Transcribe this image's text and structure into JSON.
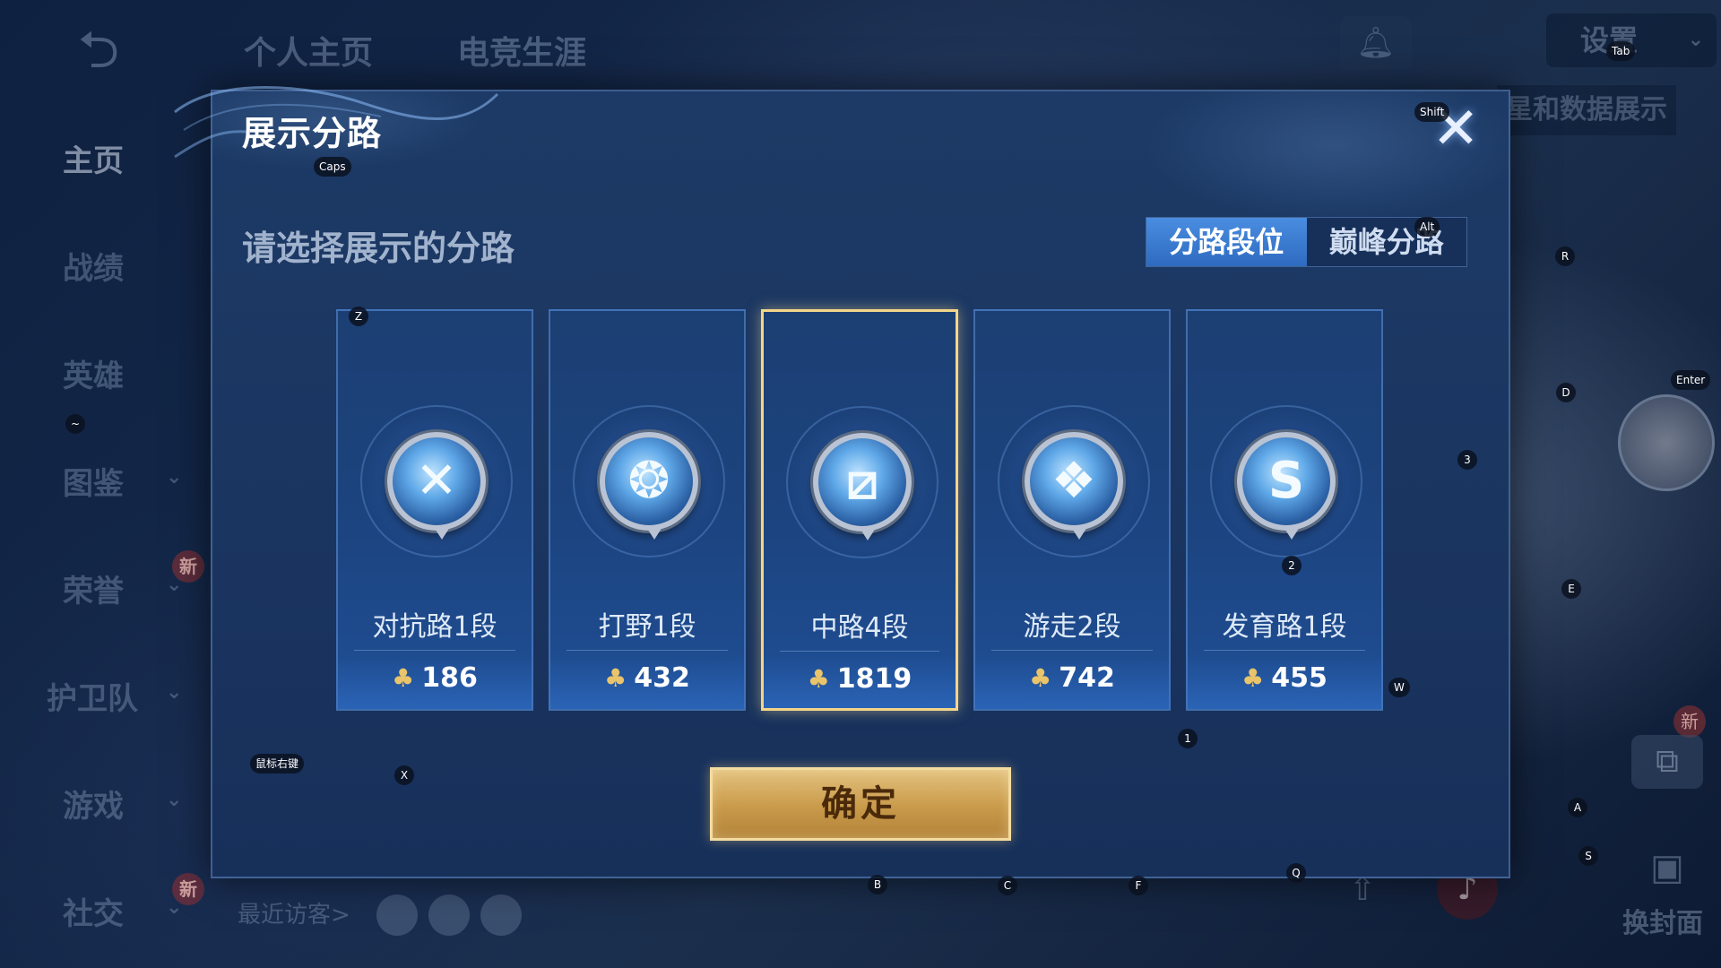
{
  "top_nav": {
    "back_icon": "back-arrow-icon",
    "tabs": [
      "个人主页",
      "电竞生涯"
    ],
    "settings_label": "设置",
    "peek_text": "星和数据展示"
  },
  "sidebar": {
    "items": [
      {
        "label": "主页"
      },
      {
        "label": "战绩"
      },
      {
        "label": "英雄"
      },
      {
        "label": "图鉴",
        "arrow": "⌄"
      },
      {
        "label": "荣誉",
        "arrow": "⌄",
        "badge": "新"
      },
      {
        "label": "护卫队",
        "arrow": "⌄"
      },
      {
        "label": "游戏",
        "arrow": "⌄"
      },
      {
        "label": "社交",
        "arrow": "⌄",
        "badge": "新"
      }
    ],
    "recent_visitors": "最近访客>"
  },
  "right_panel": {
    "new_badge": "新",
    "cover_label": "换封面"
  },
  "modal": {
    "title": "展示分路",
    "close_symbol": "✕",
    "subtitle": "请选择展示的分路",
    "tabs": [
      {
        "label": "分路段位",
        "active": true
      },
      {
        "label": "巅峰分路",
        "active": false
      }
    ],
    "cards": [
      {
        "rank": "对抗路1段",
        "score": "186",
        "emblem": "✕",
        "selected": false
      },
      {
        "rank": "打野1段",
        "score": "432",
        "emblem": "❂",
        "selected": false
      },
      {
        "rank": "中路4段",
        "score": "1819",
        "emblem": "⧄",
        "selected": true
      },
      {
        "rank": "游走2段",
        "score": "742",
        "emblem": "❖",
        "selected": false
      },
      {
        "rank": "发育路1段",
        "score": "455",
        "emblem": "S",
        "selected": false
      }
    ],
    "score_icon": "♣",
    "confirm_label": "确定"
  },
  "key_hints": {
    "tab": "Tab",
    "shift": "Shift",
    "caps": "Caps",
    "alt": "Alt",
    "enter": "Enter",
    "r": "R",
    "d": "D",
    "e": "E",
    "w": "W",
    "a": "A",
    "s": "S",
    "q": "Q",
    "z": "Z",
    "x": "X",
    "b": "B",
    "c": "C",
    "f": "F",
    "one": "1",
    "two": "2",
    "three": "3",
    "tilde": "~",
    "right_click": "鼠标右键"
  }
}
